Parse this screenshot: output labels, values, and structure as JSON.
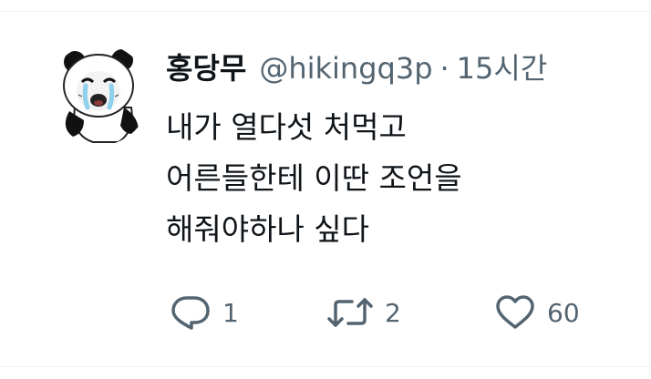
{
  "tweet": {
    "display_name": "홍당무",
    "handle": "@hikingq3p",
    "separator": "·",
    "time": "15시간",
    "text_lines": [
      "내가 열다섯 처먹고",
      "어른들한테 이딴 조언을",
      "해줘야하나 싶다"
    ],
    "avatar_icon": "panda-meme-avatar"
  },
  "actions": {
    "reply": {
      "icon": "reply-icon",
      "count": "1"
    },
    "retweet": {
      "icon": "retweet-icon",
      "count": "2"
    },
    "like": {
      "icon": "heart-icon",
      "count": "60"
    }
  },
  "colors": {
    "text_primary": "#0f1419",
    "text_secondary": "#536471",
    "divider": "#eff3f4",
    "background": "#ffffff"
  }
}
